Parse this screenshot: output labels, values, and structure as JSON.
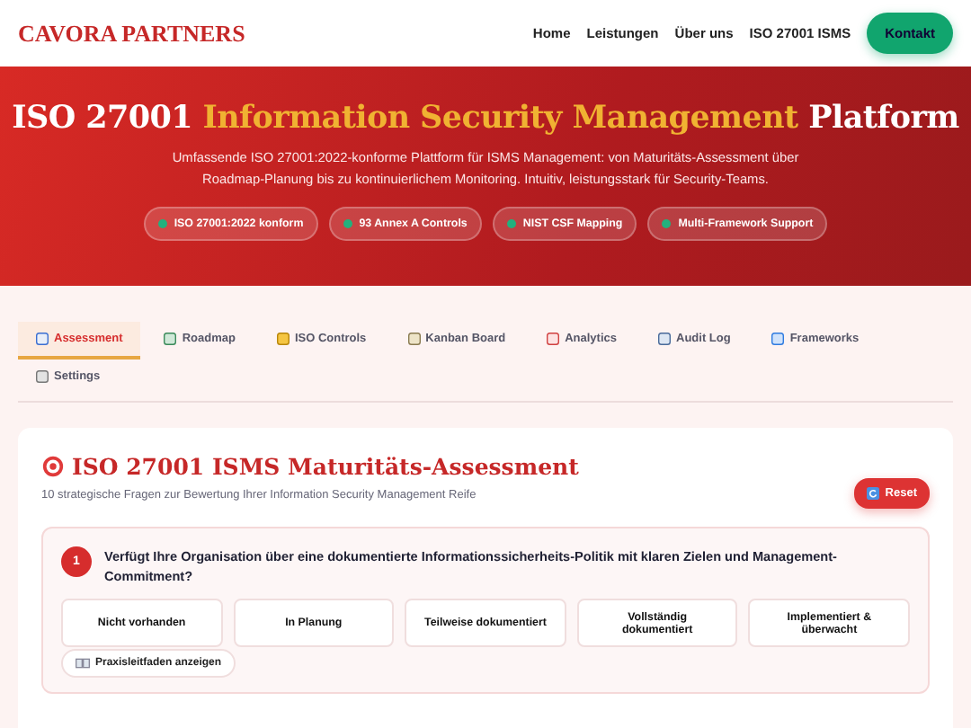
{
  "header": {
    "brand": "CAVORA PARTNERS",
    "nav": [
      "Home",
      "Leistungen",
      "Über uns",
      "ISO 27001 ISMS"
    ],
    "cta": "Kontakt"
  },
  "hero": {
    "title_start": "ISO 27001",
    "title_highlight": "Information Security Management",
    "title_end": "Platform",
    "subtitle": "Umfassende ISO 27001:2022-konforme Plattform für ISMS Management: von Maturitäts-Assessment über Roadmap-Planung bis zu kontinuierlichem Monitoring. Intuitiv, leistungsstark für Security-Teams.",
    "badges": [
      {
        "label": "ISO 27001:2022 konform",
        "color": "#22b07d"
      },
      {
        "label": "93 Annex A Controls",
        "color": "#22b07d"
      },
      {
        "label": "NIST CSF Mapping",
        "color": "#22b07d"
      },
      {
        "label": "Multi-Framework Support",
        "color": "#22b07d"
      }
    ]
  },
  "tabs": [
    {
      "label": "Assessment",
      "selected": true
    },
    {
      "label": "Roadmap",
      "selected": false
    },
    {
      "label": "ISO Controls",
      "selected": false
    },
    {
      "label": "Kanban Board",
      "selected": false
    },
    {
      "label": "Analytics",
      "selected": false
    },
    {
      "label": "Audit Log",
      "selected": false
    },
    {
      "label": "Frameworks",
      "selected": false
    },
    {
      "label": "Settings",
      "selected": false
    }
  ],
  "assessment": {
    "title": "ISO 27001 ISMS Maturitäts-Assessment",
    "subtitle": "10 strategische Fragen zur Bewertung Ihrer Information Security Management Reife",
    "reset": "Reset",
    "question": {
      "number": "1",
      "text": "Verfügt Ihre Organisation über eine dokumentierte Informationssicherheits-Politik mit klaren Zielen und Management-Commitment?",
      "options": [
        {
          "label": "Nicht vorhanden",
          "selected": false
        },
        {
          "label": "In Planung",
          "selected": false
        },
        {
          "label": "Teilweise dokumentiert",
          "selected": false
        },
        {
          "label": "Vollständig dokumentiert",
          "selected": false
        },
        {
          "label": "Implementiert & überwacht",
          "selected": false
        }
      ],
      "guide": "Praxisleitfaden anzeigen"
    }
  }
}
